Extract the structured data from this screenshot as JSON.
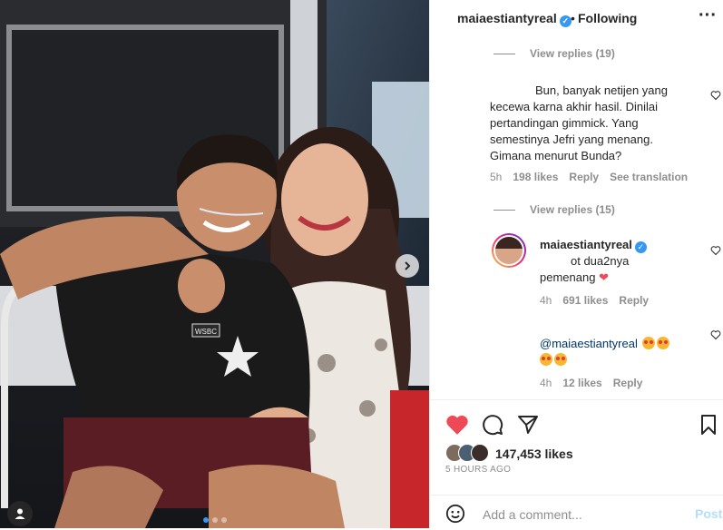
{
  "post": {
    "username": "maiaestiantyreal",
    "separator": "•",
    "follow_state": "Following",
    "more_label": "···"
  },
  "photo": {
    "jersey_text": "WSBC",
    "carousel_dots": 3,
    "active_dot": 0
  },
  "comments": {
    "view_replies_1": "View replies (19)",
    "comment_1_lines": [
      "Bun, banyak netijen yang",
      "kecewa karna akhir hasil. Dinilai",
      "pertandingan gimmick. Yang",
      "semestinya Jefri yang menang.",
      "Gimana menurut Bunda?"
    ],
    "comment_1_time": "5h",
    "comment_1_likes": "198 likes",
    "comment_1_reply": "Reply",
    "comment_1_translate": "See translation",
    "view_replies_2": "View replies (15)",
    "reply_1_username": "maiaestiantyreal",
    "reply_1_text_line1": "ot dua2nya",
    "reply_1_text_line2": "pemenang",
    "reply_1_time": "4h",
    "reply_1_likes": "691 likes",
    "reply_1_reply": "Reply",
    "reply_2_mention": "@maiaestiantyreal",
    "reply_2_time": "4h",
    "reply_2_likes": "12 likes",
    "reply_2_reply": "Reply"
  },
  "actions": {
    "likes_count": "147,453 likes",
    "timestamp": "5 HOURS AGO",
    "comment_placeholder": "Add a comment...",
    "post_label": "Post"
  },
  "colors": {
    "like_red": "#ed4956",
    "verified_blue": "#3897f0",
    "muted": "#8e8e8e",
    "post_disabled": "#b2dffc"
  }
}
